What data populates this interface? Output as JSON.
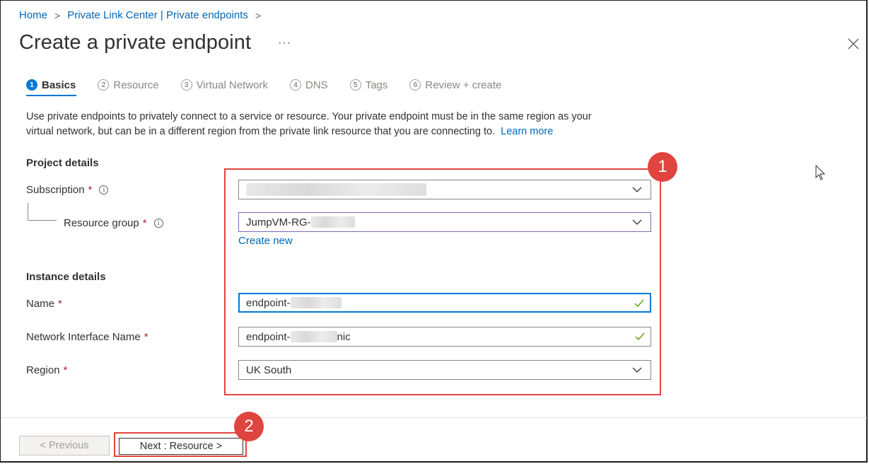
{
  "breadcrumb": {
    "home": "Home",
    "parent": "Private Link Center | Private endpoints",
    "separator": ">"
  },
  "header": {
    "title": "Create a private endpoint",
    "more": "···"
  },
  "tabs": [
    {
      "num": "1",
      "label": "Basics"
    },
    {
      "num": "2",
      "label": "Resource"
    },
    {
      "num": "3",
      "label": "Virtual Network"
    },
    {
      "num": "4",
      "label": "DNS"
    },
    {
      "num": "5",
      "label": "Tags"
    },
    {
      "num": "6",
      "label": "Review + create"
    }
  ],
  "description": {
    "line1": "Use private endpoints to privately connect to a service or resource. Your private endpoint must be in the same region as your",
    "line2": "virtual network, but can be in a different region from the private link resource that you are connecting to.",
    "learn_more": "Learn more"
  },
  "project": {
    "heading": "Project details",
    "subscription_label": "Subscription",
    "resource_group_label": "Resource group",
    "resource_group_value": "JumpVM-RG-",
    "create_new": "Create new",
    "required_mark": "*"
  },
  "instance": {
    "heading": "Instance details",
    "name_label": "Name",
    "name_value": "endpoint-",
    "nic_label": "Network Interface Name",
    "nic_value_prefix": "endpoint-",
    "nic_value_suffix": "nic",
    "region_label": "Region",
    "region_value": "UK South"
  },
  "annotations": {
    "badge1": "1",
    "badge2": "2",
    "highlight_color": "#e0443e"
  },
  "footer": {
    "previous": "< Previous",
    "next": "Next : Resource >"
  },
  "colors": {
    "accent": "#0078d4",
    "link": "#0067b8",
    "valid": "#57a300"
  }
}
